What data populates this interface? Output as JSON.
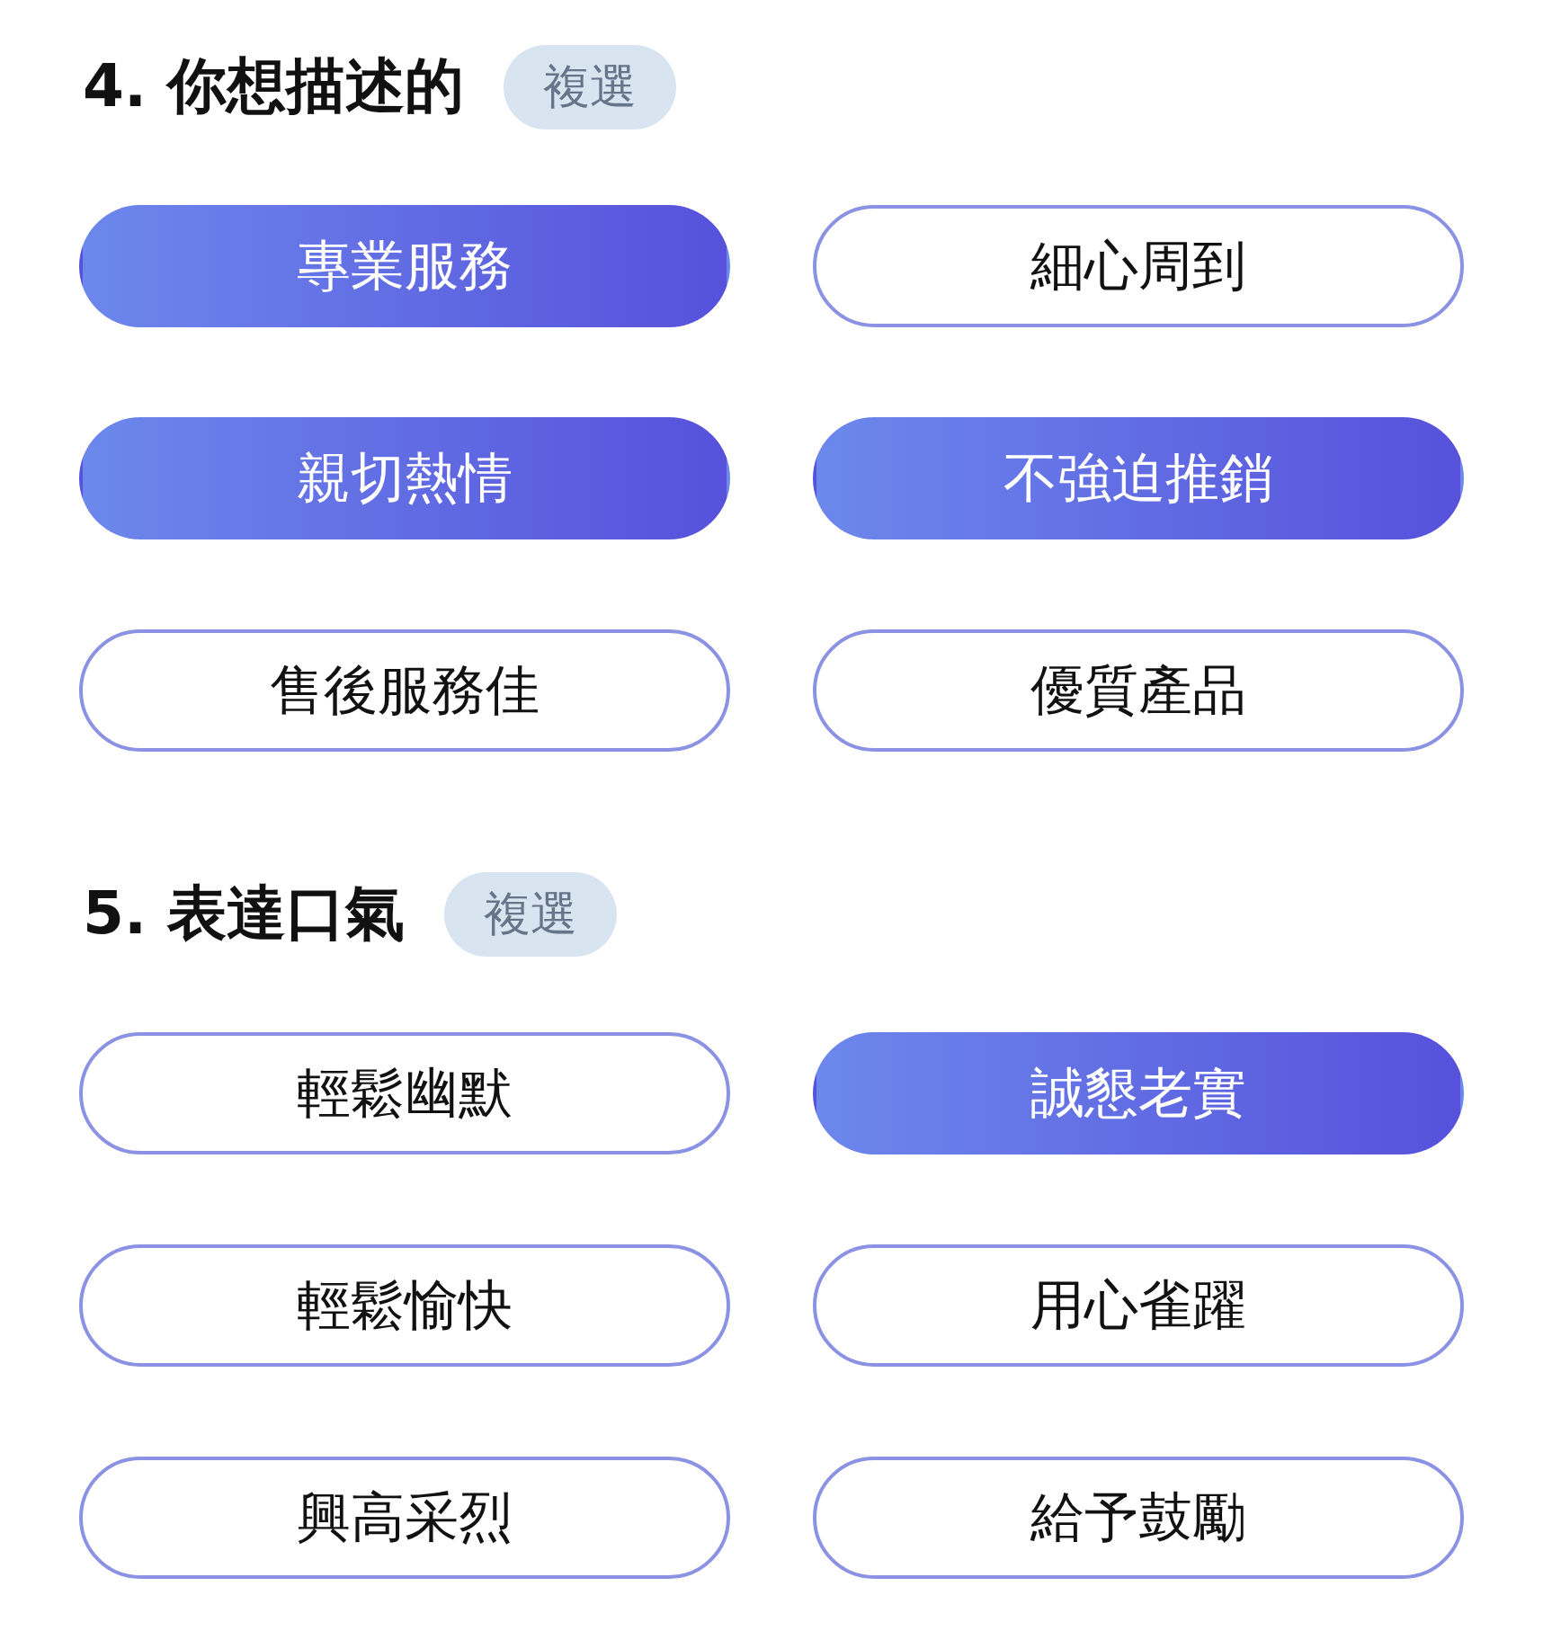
{
  "sections": [
    {
      "title": "4. 你想描述的",
      "badge": "複選",
      "options": [
        {
          "label": "專業服務",
          "selected": true
        },
        {
          "label": "細心周到",
          "selected": false
        },
        {
          "label": "親切熱情",
          "selected": true
        },
        {
          "label": "不強迫推銷",
          "selected": true
        },
        {
          "label": "售後服務佳",
          "selected": false
        },
        {
          "label": "優質產品",
          "selected": false
        }
      ]
    },
    {
      "title": "5. 表達口氣",
      "badge": "複選",
      "options": [
        {
          "label": "輕鬆幽默",
          "selected": false
        },
        {
          "label": "誠懇老實",
          "selected": true
        },
        {
          "label": "輕鬆愉快",
          "selected": false
        },
        {
          "label": "用心雀躍",
          "selected": false
        },
        {
          "label": "興高采烈",
          "selected": false
        },
        {
          "label": "給予鼓勵",
          "selected": false
        }
      ]
    }
  ]
}
